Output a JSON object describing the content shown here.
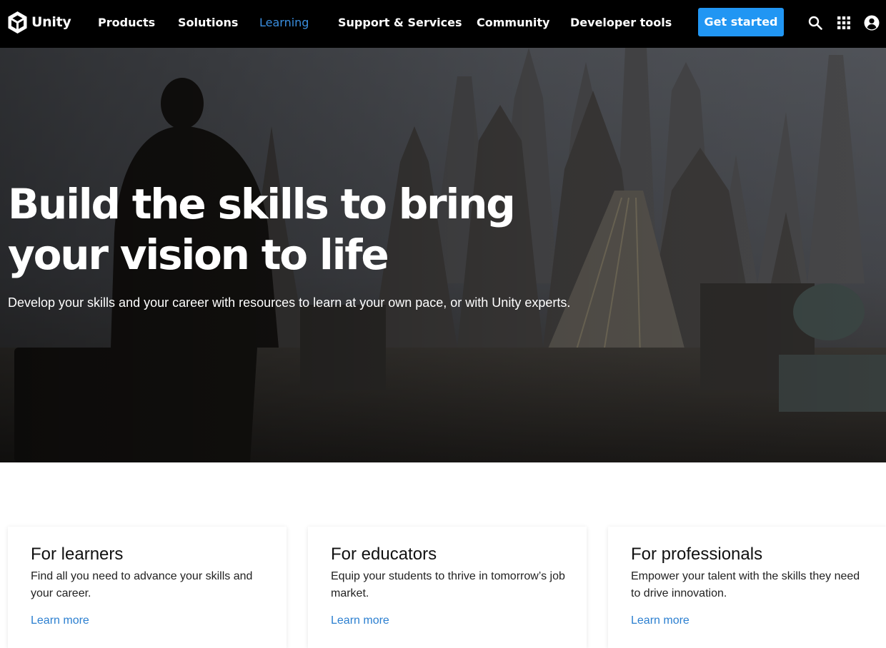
{
  "brand": {
    "name": "Unity"
  },
  "nav": {
    "items": [
      {
        "label": "Products",
        "active": false
      },
      {
        "label": "Solutions",
        "active": false
      },
      {
        "label": "Learning",
        "active": true
      },
      {
        "label": "Support & Services",
        "active": false
      },
      {
        "label": "Community",
        "active": false
      },
      {
        "label": "Developer tools",
        "active": false
      }
    ],
    "cta_label": "Get started",
    "icons": [
      "search-icon",
      "apps-grid-icon",
      "account-icon"
    ]
  },
  "hero": {
    "title_line1": "Build the skills to bring",
    "title_line2": "your vision to life",
    "subtitle": "Develop your skills and your career with resources to learn at your own pace, or with Unity experts."
  },
  "cards": [
    {
      "title": "For learners",
      "text": "Find all you need to advance your skills and your career.",
      "link": "Learn more"
    },
    {
      "title": "For educators",
      "text": "Equip your students to thrive in tomorrow’s job market.",
      "link": "Learn more"
    },
    {
      "title": "For professionals",
      "text": "Empower your talent with the skills they need to drive innovation.",
      "link": "Learn more"
    }
  ],
  "colors": {
    "nav_bg": "#000000",
    "accent": "#2196f3",
    "active_nav": "#3a8fe0",
    "link": "#2b7fd0"
  }
}
